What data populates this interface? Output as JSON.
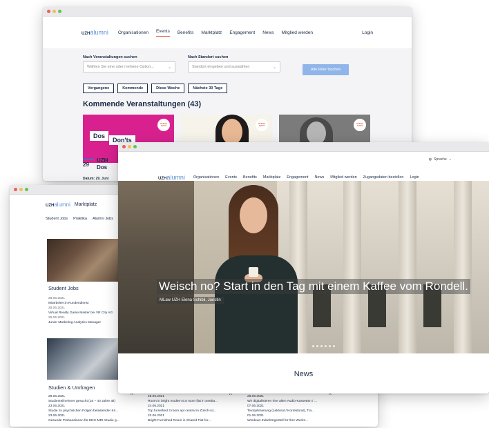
{
  "events_window": {
    "logo_prefix": "UZH",
    "logo_suffix": "alumni",
    "nav": [
      "Organisationen",
      "Events",
      "Benefits",
      "Marktplatz",
      "Engagement",
      "News",
      "Mitglied werden"
    ],
    "active_nav": "Events",
    "login": "Login",
    "search_events_label": "Nach Veranstaltungen suchen",
    "search_events_placeholder": "Wählen Sie eine oder mehrere Option...",
    "search_location_label": "Nach Standort suchen",
    "search_location_placeholder": "Standort eingeben und auswählen",
    "clear_filters": "Alle Filter löschen",
    "filter_buttons": [
      "Vergangene",
      "Kommende",
      "Diese Woche",
      "Nächste 30 Tage"
    ],
    "heading": "Kommende Veranstaltungen (43)",
    "card1_bubbles": [
      "Dos",
      "Don'ts"
    ],
    "date_day": "29",
    "event_title_prefix": "UZH",
    "event_title_2": "Dos",
    "date_line": "Datum: 29. Juni",
    "badge_text": "alumni event"
  },
  "market_window": {
    "logo_prefix": "UZH",
    "logo_suffix": "alumni",
    "section": "Marktplatz",
    "subnav": [
      "Student Jobs",
      "Praktika",
      "Alumni Jobs"
    ],
    "student_jobs_title": "Student Jobs",
    "student_jobs": [
      {
        "date": "28.06.2021",
        "text": "Mitarbeiter:in Kundendienst"
      },
      {
        "date": "28.06.2021",
        "text": "Virtual Reality Game Master bei VR City AG"
      },
      {
        "date": "26.06.2021",
        "text": "Junior Marketing Analytics Manager"
      }
    ],
    "studien_title": "Studien & Umfragen",
    "studien": [
      {
        "date": "28.06.2021",
        "text": "Studienteilnehmer gesucht (18 – 40 Jahre alt)"
      },
      {
        "date": "23.06.2021",
        "text": "Studie zu psychischen Folgen belastender Kri..."
      },
      {
        "date": "23.06.2021",
        "text": "Gesunde Probandinnen für EEG-MRI-Studie g..."
      }
    ],
    "wohnen": [
      {
        "date": "28.06.2021",
        "text": "Room in bright modern 5.5 room flat in Seeba..."
      },
      {
        "date": "24.06.2021",
        "text": "Top furnished 3 room apt central in Zürich-cit..."
      },
      {
        "date": "23.06.2021",
        "text": "Bright Furnished Room in Shared Flat for..."
      }
    ],
    "angebote": [
      {
        "date": "28.06.2021",
        "text": "Wir digitalisieren Ihre alten Audio-Kassetten / ..."
      },
      {
        "date": "07.06.2021",
        "text": "Textoptimierung (Lektorat / Korrektorat), Tra..."
      },
      {
        "date": "01.06.2021",
        "text": "Windows Zubehörgestell für Ihre Werkz..."
      }
    ]
  },
  "home_window": {
    "language": "Sprache",
    "logo_prefix": "UZH",
    "logo_suffix": "alumni",
    "nav": [
      "Organisationen",
      "Events",
      "Benefits",
      "Marktplatz",
      "Engagement",
      "News",
      "Mitglied werden",
      "Zugangsdaten bestellen",
      "Login"
    ],
    "hero_title": "Weisch no? Start in den Tag mit einem Kaffee vom Rondell.",
    "hero_caption": "MLaw UZH Elena Schibli, Juristin",
    "news_heading": "News"
  },
  "colors": {
    "brand": "#1a2b44",
    "accent_blue": "#5b8fd6",
    "accent_red": "#e0532f",
    "button_blue": "#8fb5ea",
    "card_pink": "#d8218f"
  }
}
